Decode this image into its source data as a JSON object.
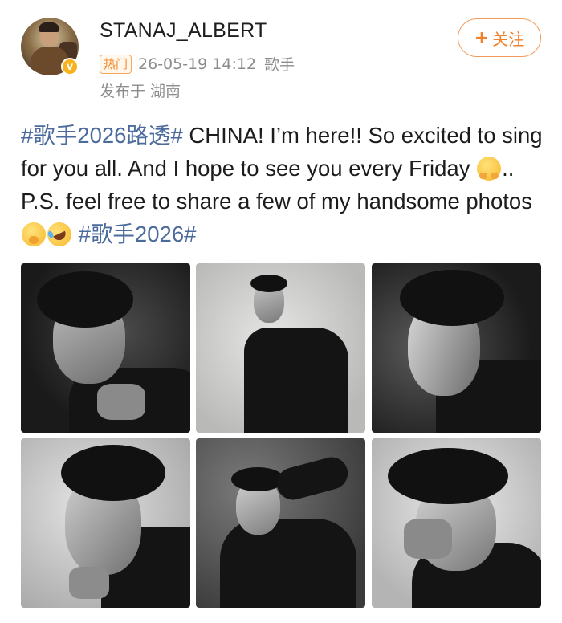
{
  "header": {
    "username": "STANAJ_ALBERT",
    "hot_label": "热门",
    "timestamp": "26-05-19 14:12",
    "source": "歌手",
    "location": "发布于 湖南",
    "follow_label": "关注",
    "follow_plus": "+"
  },
  "post": {
    "tag1": "#歌手2026路透#",
    "text1": " CHINA! I’m here!! So excited to sing for you all. And I hope to see you every Friday ",
    "text2": ".. P.S. feel free to share a few of my handsome photos ",
    "tag2": "#歌手2026#",
    "emojis": [
      "smiling-face-with-open-hands",
      "face-with-hand-over-mouth",
      "rolling-on-floor-laughing"
    ]
  },
  "photos": [
    {
      "id": 1,
      "tone": "dark"
    },
    {
      "id": 2,
      "tone": "light"
    },
    {
      "id": 3,
      "tone": "dark"
    },
    {
      "id": 4,
      "tone": "light"
    },
    {
      "id": 5,
      "tone": "mid"
    },
    {
      "id": 6,
      "tone": "light"
    }
  ],
  "colors": {
    "accent": "#f0822d",
    "link": "#4b6b9c",
    "meta": "#8c8c8c",
    "verified": "#f7b21d"
  }
}
